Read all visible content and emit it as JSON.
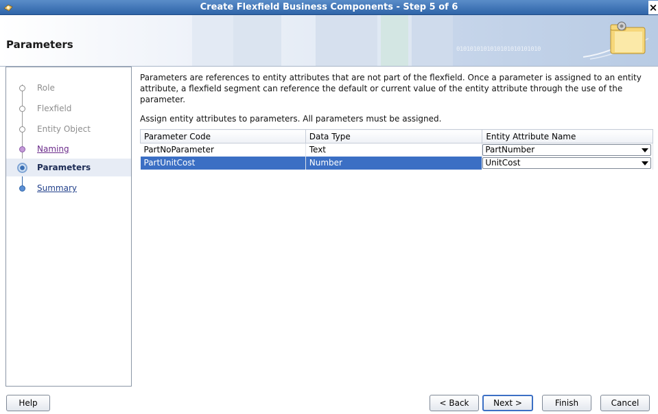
{
  "window": {
    "title": "Create Flexfield Business Components - Step 5 of 6",
    "close_glyph": "×"
  },
  "header": {
    "title": "Parameters",
    "binary_decoration": "0101010101010101010101010"
  },
  "steps": [
    {
      "label": "Role",
      "state": "disabled"
    },
    {
      "label": "Flexfield",
      "state": "disabled"
    },
    {
      "label": "Entity Object",
      "state": "disabled"
    },
    {
      "label": "Naming",
      "state": "visited"
    },
    {
      "label": "Parameters",
      "state": "current"
    },
    {
      "label": "Summary",
      "state": "next"
    }
  ],
  "main": {
    "description": "Parameters are references to entity attributes that are not part of the flexfield.  Once a parameter is assigned to an entity attribute, a flexfield segment can reference the default or current value of the entity attribute through the use of the parameter.",
    "instruction": "Assign entity attributes to parameters.  All parameters must be assigned."
  },
  "table": {
    "columns": [
      "Parameter Code",
      "Data Type",
      "Entity Attribute Name"
    ],
    "rows": [
      {
        "code": "PartNoParameter",
        "type": "Text",
        "attribute": "PartNumber",
        "selected": false
      },
      {
        "code": "PartUnitCost",
        "type": "Number",
        "attribute": "UnitCost",
        "selected": true
      }
    ]
  },
  "buttons": {
    "help": "Help",
    "back": "< Back",
    "next": "Next >",
    "finish": "Finish",
    "cancel": "Cancel"
  },
  "colors": {
    "titlebar": "#2f64a8",
    "selection": "#3b6fc4"
  }
}
